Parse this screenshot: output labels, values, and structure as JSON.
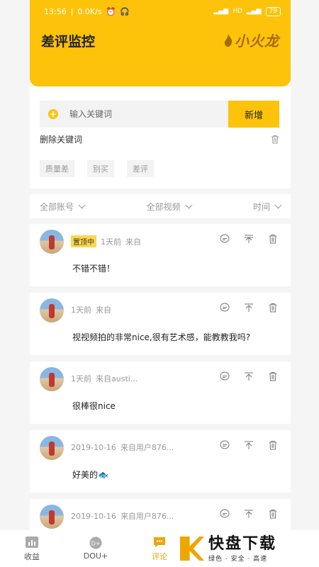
{
  "status_bar": {
    "time": "13:56",
    "speed": "0.0K/s",
    "battery": "79"
  },
  "header": {
    "title": "差评监控",
    "brand": "小火龙"
  },
  "keyword": {
    "placeholder": "输入关键词",
    "add_label": "新增",
    "delete_label": "删除关键词",
    "tags": [
      "质量差",
      "别买",
      "差评"
    ]
  },
  "filters": {
    "account": "全部账号",
    "video": "全部视频",
    "time": "时间"
  },
  "comments": [
    {
      "pinned_label": "置顶中",
      "date": "1天前",
      "source": "来自",
      "text": "不错不错！"
    },
    {
      "date": "1天前",
      "source": "来自",
      "text": "视视频拍的非常nice,很有艺术感，能教教我吗?"
    },
    {
      "date": "1天前",
      "source": "来自austi...",
      "text": "很棒很nice"
    },
    {
      "date": "2019-10-16",
      "source": "来自用户876...",
      "text": "好美的🐟"
    },
    {
      "date": "2019-10-16",
      "source": "来自用户876...",
      "text": ""
    }
  ],
  "bottom_nav": {
    "items": [
      "收益",
      "DOU+",
      "评论"
    ],
    "active_index": 2
  },
  "watermark": {
    "main": "快盘下载",
    "sub": "绿色 · 安全 · 高速"
  },
  "colors": {
    "accent": "#fcc30a",
    "active_nav": "#f0a500",
    "watermark_green": "#1a9d3c"
  }
}
